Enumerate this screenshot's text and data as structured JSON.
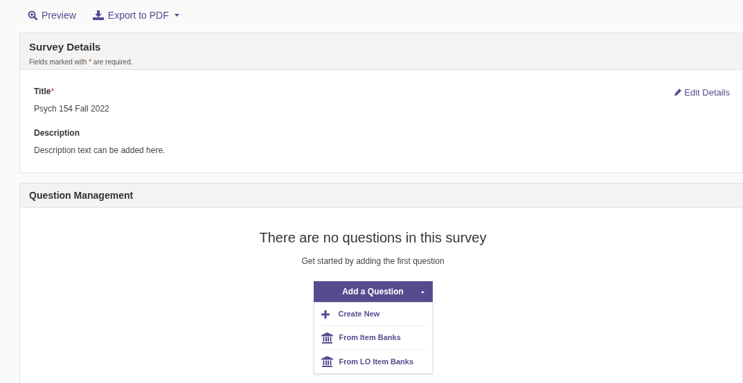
{
  "toolbar": [
    {
      "kind": "preview",
      "label": "Preview",
      "dropdown": false
    },
    {
      "kind": "export",
      "label": "Export to PDF",
      "dropdown": true
    }
  ],
  "survey_details": {
    "title": "Survey Details",
    "hint": [
      {
        "kind": "plain",
        "text": "Fields marked with "
      },
      {
        "kind": "mark",
        "text": "*"
      },
      {
        "kind": "plain",
        "text": " are required."
      }
    ],
    "edit_link": "Edit Details",
    "fields": [
      {
        "label": "Title",
        "required_mark": "*",
        "value": "Psych 154 Fall 2022"
      },
      {
        "label": "Description",
        "value": "Description text can be added here."
      }
    ]
  },
  "question_management": {
    "title": "Question Management",
    "empty_title": "There are no questions in this survey",
    "empty_subtitle": "Get started by adding the first question",
    "add_button": {
      "label": "Add a Question",
      "expanded": true,
      "items": [
        {
          "kind": "plus",
          "label": "Create New"
        },
        {
          "kind": "bank",
          "label": "From Item Banks"
        },
        {
          "kind": "bank",
          "label": "From LO Item Banks"
        }
      ]
    }
  }
}
